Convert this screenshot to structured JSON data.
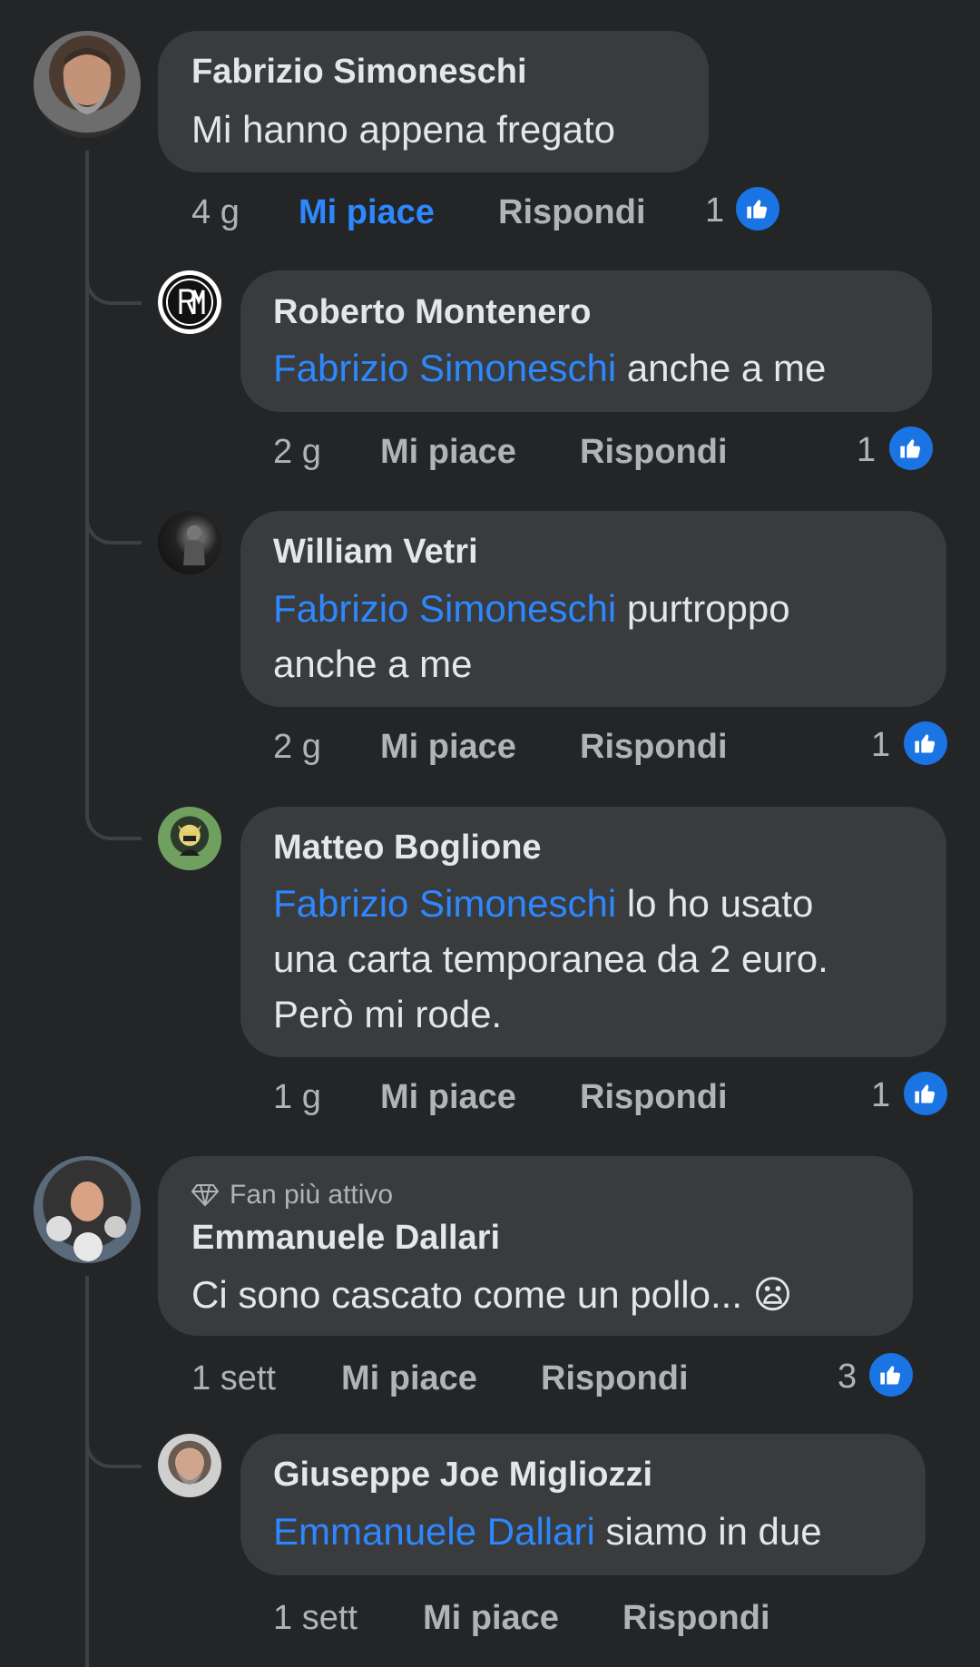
{
  "comments": [
    {
      "author": "Fabrizio Simoneschi",
      "text": "Mi hanno appena fregato",
      "time": "4 g",
      "like_label": "Mi piace",
      "reply_label": "Rispondi",
      "reaction_count": "1",
      "replies": [
        {
          "author": "Roberto Montenero",
          "mention": "Fabrizio Simoneschi",
          "text": "anche a me",
          "time": "2 g",
          "like_label": "Mi piace",
          "reply_label": "Rispondi",
          "reaction_count": "1"
        },
        {
          "author": "William Vetri",
          "mention": "Fabrizio Simoneschi",
          "text_line1": "purtroppo",
          "text_line2": "anche a me",
          "time": "2 g",
          "like_label": "Mi piace",
          "reply_label": "Rispondi",
          "reaction_count": "1"
        },
        {
          "author": "Matteo Boglione",
          "mention": "Fabrizio Simoneschi",
          "text_line1": "lo ho usato",
          "text_line2": "una carta temporanea da 2 euro.",
          "text_line3": "Però mi rode.",
          "time": "1 g",
          "like_label": "Mi piace",
          "reply_label": "Rispondi",
          "reaction_count": "1"
        }
      ]
    },
    {
      "badge": "Fan più attivo",
      "author": "Emmanuele Dallari",
      "text": "Ci sono cascato come un pollo...",
      "emoji": "😦",
      "time": "1 sett",
      "like_label": "Mi piace",
      "reply_label": "Rispondi",
      "reaction_count": "3",
      "replies": [
        {
          "author": "Giuseppe Joe Migliozzi",
          "mention": "Emmanuele Dallari",
          "text": "siamo in due",
          "time": "1 sett",
          "like_label": "Mi piace",
          "reply_label": "Rispondi"
        }
      ]
    }
  ],
  "colors": {
    "background": "#242526",
    "bubble": "#3a3b3c",
    "mention": "#2d88ff",
    "like_active": "#2d88ff",
    "like_badge": "#1b74e4",
    "secondary_text": "#b0b3b8"
  },
  "icons": {
    "reaction": "thumbs-up-icon",
    "badge": "diamond-icon"
  }
}
